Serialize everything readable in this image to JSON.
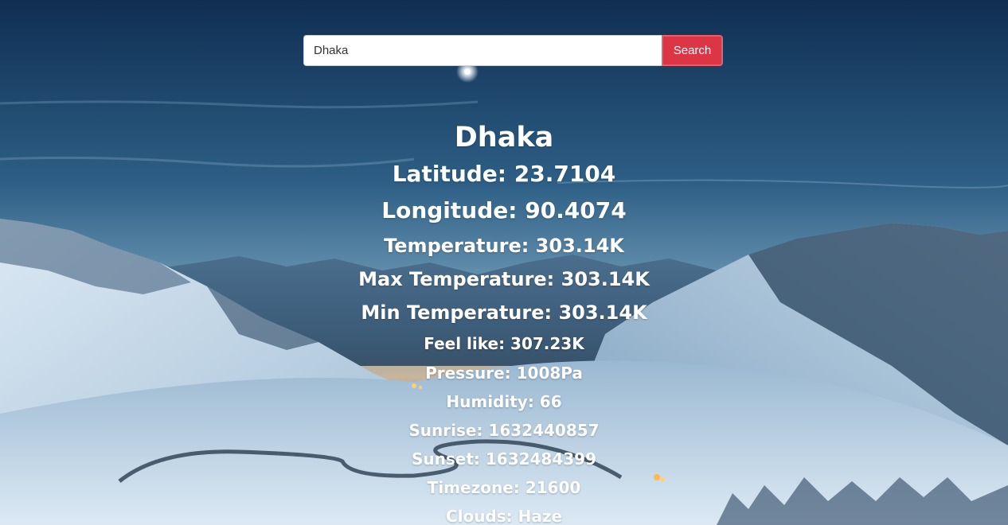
{
  "search": {
    "value": "Dhaka",
    "button_label": "Search"
  },
  "weather": {
    "city": "Dhaka",
    "latitude": "Latitude: 23.7104",
    "longitude": "Longitude: 90.4074",
    "temperature": "Temperature: 303.14K",
    "max_temperature": "Max Temperature: 303.14K",
    "min_temperature": "Min Temperature: 303.14K",
    "feels_like": "Feel like: 307.23K",
    "pressure": "Pressure: 1008Pa",
    "humidity": "Humidity: 66",
    "sunrise": "Sunrise: 1632440857",
    "sunset": "Sunset: 1632484399",
    "timezone": "Timezone: 21600",
    "clouds": "Clouds: Haze"
  },
  "colors": {
    "button": "#dc3545",
    "text": "#ffffff",
    "sky_top": "#0f2e52",
    "sky_horizon": "#7fa9c2",
    "snow": "#cfe0ee"
  }
}
